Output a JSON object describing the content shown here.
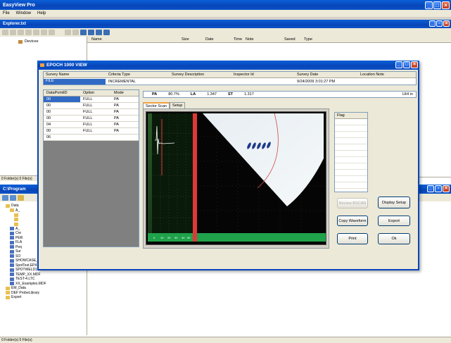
{
  "main_window": {
    "title": "EasyView Pro",
    "menu": [
      "File",
      "Window",
      "Help"
    ]
  },
  "explorer": {
    "title": "Explorer.txt",
    "tree_root": "Devices",
    "columns": [
      "Name",
      "Size",
      "Date",
      "Time",
      "Note",
      "Saved",
      "Type"
    ],
    "status": "0 Folder(s) 0 File(s)"
  },
  "program_window": {
    "title": "C:\\Program",
    "tree": [
      {
        "label": "Data",
        "level": 1,
        "icon": "folder"
      },
      {
        "label": "A_",
        "level": 2,
        "icon": "folder"
      },
      {
        "label": "",
        "level": 3,
        "icon": "folder"
      },
      {
        "label": "",
        "level": 3,
        "icon": "folder"
      },
      {
        "label": "",
        "level": 3,
        "icon": "folder"
      },
      {
        "label": "A_",
        "level": 2,
        "icon": "file"
      },
      {
        "label": "Cre",
        "level": 2,
        "icon": "file"
      },
      {
        "label": "PER",
        "level": 2,
        "icon": "file"
      },
      {
        "label": "FLA",
        "level": 2,
        "icon": "file"
      },
      {
        "label": "Peq",
        "level": 2,
        "icon": "file"
      },
      {
        "label": "Sur",
        "level": 2,
        "icon": "file"
      },
      {
        "label": "SO",
        "level": 2,
        "icon": "file"
      },
      {
        "label": "SHOWCASE_PA.MDF",
        "level": 2,
        "icon": "file"
      },
      {
        "label": "SpotTest.EP4",
        "level": 2,
        "icon": "file"
      },
      {
        "label": "SPOTWELD1.EP4",
        "level": 2,
        "icon": "file"
      },
      {
        "label": "TEMP_XX.MDF",
        "level": 2,
        "icon": "file"
      },
      {
        "label": "TEST-4.LTC",
        "level": 2,
        "icon": "file"
      },
      {
        "label": "XX_Examples.MDF",
        "level": 2,
        "icon": "file"
      },
      {
        "label": "EM_Data",
        "level": 1,
        "icon": "folder"
      },
      {
        "label": "DEF ProbeLibrary",
        "level": 1,
        "icon": "folder"
      },
      {
        "label": "Export",
        "level": 1,
        "icon": "folder"
      }
    ],
    "status": "0 Folder(s) 0 File(s)",
    "status_top": "0 Folder(s) 0 File(s)"
  },
  "dialog": {
    "title": "EPOCH 1000 VIEW",
    "survey_headers": [
      "Survey Name",
      "Criteria Type",
      "Survey Description",
      "Inspector Id",
      "Survey Date",
      "Location Note"
    ],
    "survey_values": [
      "FILE",
      "INCREMENTAL",
      "",
      "",
      "9/24/2009 3:01:27 PM",
      ""
    ],
    "data_headers": [
      "DataPointID",
      "Option",
      "Mode"
    ],
    "data_rows": [
      [
        "00",
        "FULL",
        "PA"
      ],
      [
        "00",
        "FULL",
        "PA"
      ],
      [
        "00",
        "FULL",
        "PA"
      ],
      [
        "00",
        "FULL",
        "PA"
      ],
      [
        "04",
        "FULL",
        "PA"
      ],
      [
        "00",
        "FULL",
        "PA"
      ],
      [
        "06",
        "",
        ""
      ]
    ],
    "readouts": [
      {
        "label": "PA",
        "value": "80.7%"
      },
      {
        "label": "LA",
        "value": "1.347"
      },
      {
        "label": "ST",
        "value": "1.317"
      }
    ],
    "readout_unit": "UHI in",
    "tabs": [
      "Sector Scan",
      "Setup"
    ],
    "flag_header": "Flag",
    "buttons": {
      "review_bscan": "Review BSCAN",
      "display_setup": "Display Setup",
      "copy_waveform": "Copy Waveform",
      "export": "Export",
      "print": "Print",
      "ok": "Ok"
    },
    "axis_ticks": [
      "0",
      "10",
      "20",
      "30",
      "40",
      "50"
    ]
  },
  "colors": {
    "title_blue": "#0845b8",
    "dialog_bg": "#ece9d8",
    "scan_bg": "#000000",
    "gate_green": "#1fa24a",
    "gate_red": "#e03838",
    "selection": "#316ac5"
  }
}
